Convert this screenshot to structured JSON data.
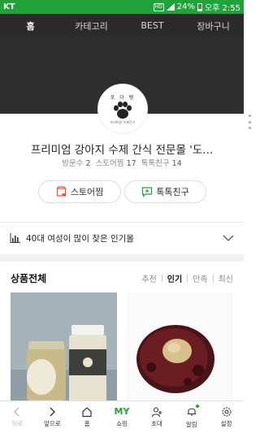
{
  "status_bar": {
    "carrier": "KT",
    "hd_badge": "HD",
    "battery": "24%",
    "time": "오후 2:55"
  },
  "top_nav": {
    "tabs": [
      {
        "label": "홈",
        "active": true
      },
      {
        "label": "카테고리",
        "active": false
      },
      {
        "label": "BEST",
        "active": false
      },
      {
        "label": "장바구니",
        "active": false
      }
    ]
  },
  "profile": {
    "logo_text_top": "포 더 펫",
    "logo_text_bottom": "프리미엄 수제간식",
    "store_name": "프리미엄 강아지 수제 간식 전문몰 '도...",
    "stats": [
      {
        "label": "방문수",
        "value": "2"
      },
      {
        "label": "스토어찜",
        "value": "17"
      },
      {
        "label": "톡톡친구",
        "value": "14"
      }
    ],
    "buttons": {
      "zzim": "스토어찜",
      "talk": "톡톡친구"
    }
  },
  "popular": {
    "text": "40대 여성이 많이 찾은 인기몰"
  },
  "products_section": {
    "title": "상품전체",
    "sort_options": [
      {
        "label": "추천",
        "active": false
      },
      {
        "label": "인기",
        "active": true
      },
      {
        "label": "만족",
        "active": false
      },
      {
        "label": "최신",
        "active": false
      }
    ]
  },
  "bottom_bar": {
    "items": [
      {
        "label": "뒤로",
        "icon": "back-icon"
      },
      {
        "label": "앞으로",
        "icon": "forward-icon"
      },
      {
        "label": "홈",
        "icon": "home-icon"
      },
      {
        "label": "쇼핑",
        "icon": "my-shopping-icon",
        "icon_text": "MY"
      },
      {
        "label": "초대",
        "icon": "invite-icon"
      },
      {
        "label": "알림",
        "icon": "bell-icon"
      },
      {
        "label": "설정",
        "icon": "gear-icon"
      }
    ]
  },
  "colors": {
    "brand_green": "#1fa33a",
    "nav_dark": "#2b2b2b",
    "zzim_red": "#e8503a",
    "talk_green": "#1fa33a"
  }
}
